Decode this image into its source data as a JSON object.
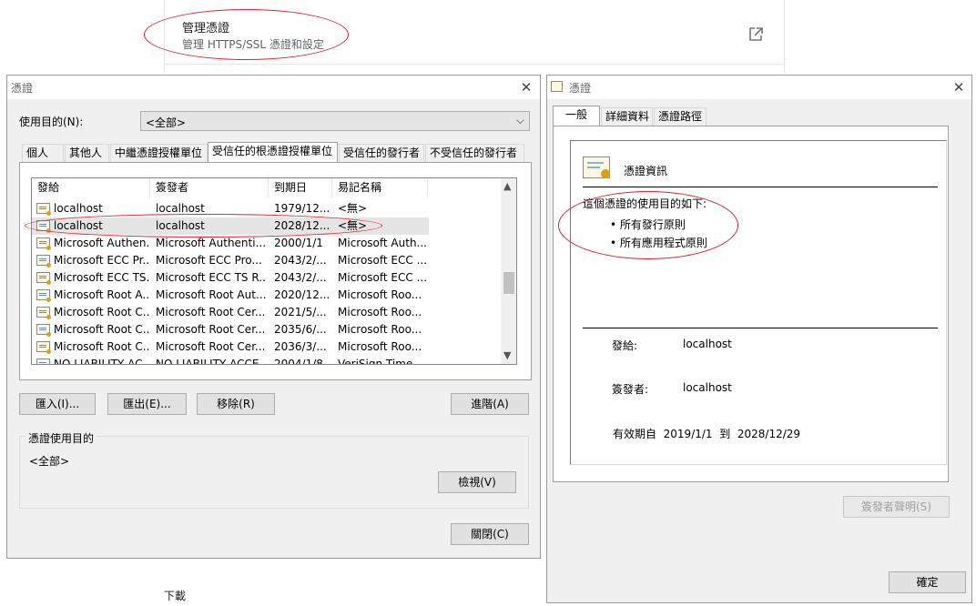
{
  "background_page": {
    "title": "管理憑證",
    "subtitle": "管理 HTTPS/SSL 憑證和設定",
    "external_icon": "open-in-new-icon",
    "download_label": "下載"
  },
  "cert_manager": {
    "title": "憑證",
    "purpose_label": "使用目的(N):",
    "purpose_value": "<全部>",
    "tabs": [
      "個人",
      "其他人",
      "中繼憑證授權單位",
      "受信任的根憑證授權單位",
      "受信任的發行者",
      "不受信任的發行者"
    ],
    "active_tab": 3,
    "columns": [
      "發給",
      "簽發者",
      "到期日",
      "易記名稱"
    ],
    "rows": [
      {
        "issued_to": "localhost",
        "issued_by": "localhost",
        "expires": "1979/12...",
        "friendly": "<無>"
      },
      {
        "issued_to": "localhost",
        "issued_by": "localhost",
        "expires": "2028/12...",
        "friendly": "<無>"
      },
      {
        "issued_to": "Microsoft Authen...",
        "issued_by": "Microsoft Authenti...",
        "expires": "2000/1/1",
        "friendly": "Microsoft Auth..."
      },
      {
        "issued_to": "Microsoft ECC Pr...",
        "issued_by": "Microsoft ECC Pro...",
        "expires": "2043/2/...",
        "friendly": "Microsoft ECC ..."
      },
      {
        "issued_to": "Microsoft ECC TS...",
        "issued_by": "Microsoft ECC TS R...",
        "expires": "2043/2/...",
        "friendly": "Microsoft ECC ..."
      },
      {
        "issued_to": "Microsoft Root A...",
        "issued_by": "Microsoft Root Aut...",
        "expires": "2020/12...",
        "friendly": "Microsoft Roo..."
      },
      {
        "issued_to": "Microsoft Root C...",
        "issued_by": "Microsoft Root Cer...",
        "expires": "2021/5/...",
        "friendly": "Microsoft Roo..."
      },
      {
        "issued_to": "Microsoft Root C...",
        "issued_by": "Microsoft Root Cer...",
        "expires": "2035/6/...",
        "friendly": "Microsoft Roo..."
      },
      {
        "issued_to": "Microsoft Root C...",
        "issued_by": "Microsoft Root Cer...",
        "expires": "2036/3/...",
        "friendly": "Microsoft Roo..."
      },
      {
        "issued_to": "NO LIABILITY AC...",
        "issued_by": "NO LIABILITY ACCE...",
        "expires": "2004/1/8",
        "friendly": "VeriSign Time..."
      }
    ],
    "selected_row": 1,
    "buttons": {
      "import": "匯入(I)...",
      "export": "匯出(E)...",
      "remove": "移除(R)",
      "advanced": "進階(A)",
      "view": "檢視(V)",
      "close": "關閉(C)"
    },
    "group_title": "憑證使用目的",
    "group_value": "<全部>"
  },
  "cert_detail": {
    "title": "憑證",
    "tabs": [
      "一般",
      "詳細資料",
      "憑證路徑"
    ],
    "active_tab": 0,
    "info_title": "憑證資訊",
    "purpose_heading": "這個憑證的使用目的如下:",
    "purposes": [
      "所有發行原則",
      "所有應用程式原則"
    ],
    "issued_to_label": "發給:",
    "issued_to_value": "localhost",
    "issued_by_label": "簽發者:",
    "issued_by_value": "localhost",
    "validity_label": "有效期自",
    "valid_from": "2019/1/1",
    "to_label": "到",
    "valid_to": "2028/12/29",
    "issuer_statement_button": "簽發者聲明(S)",
    "ok_button": "確定"
  },
  "colors": {
    "annotation": "#d9262c",
    "selection": "#e5e5e5"
  }
}
